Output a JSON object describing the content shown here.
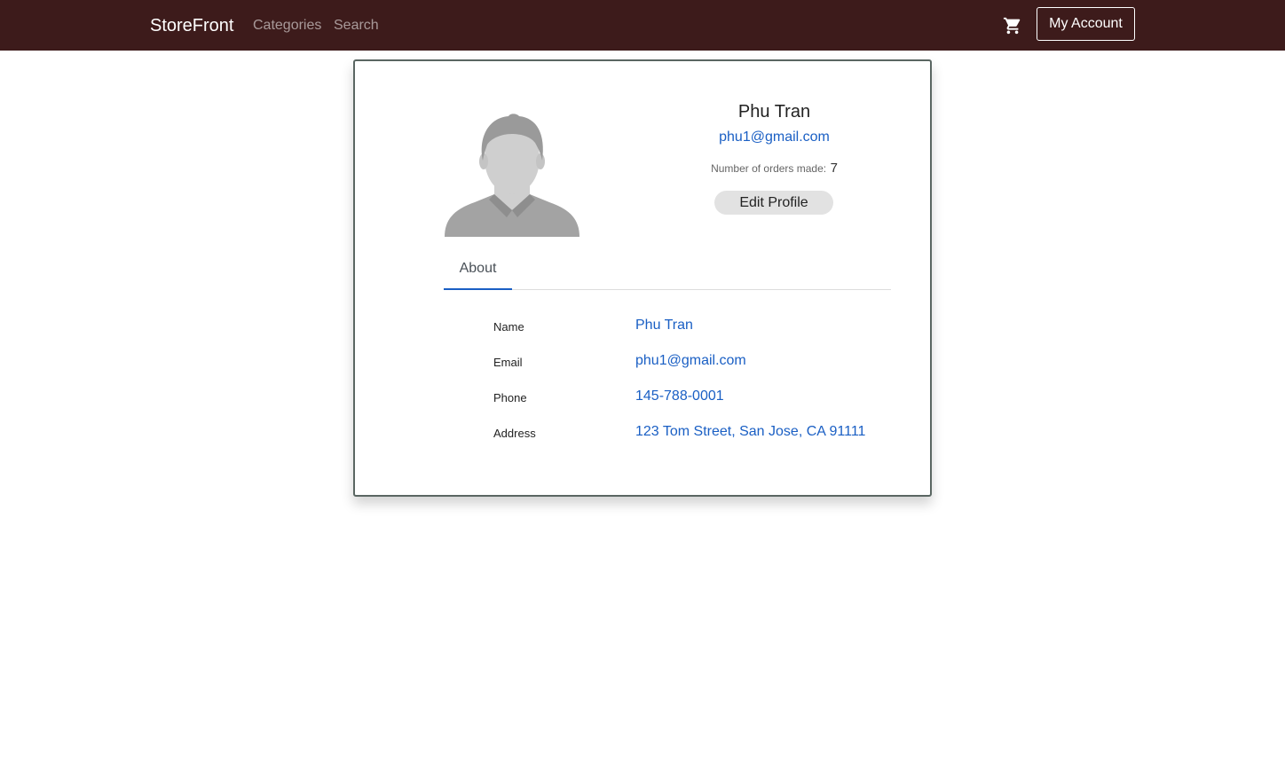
{
  "navbar": {
    "brand": "StoreFront",
    "links": [
      "Categories",
      "Search"
    ],
    "cart_icon": "shopping-cart-icon",
    "account_button": "My Account",
    "background_color": "#3d1b1b"
  },
  "profile": {
    "name": "Phu Tran",
    "email": "phu1@gmail.com",
    "orders_label": "Number of orders made:",
    "orders_count": "7",
    "edit_button": "Edit Profile",
    "avatar_icon": "user-avatar-icon"
  },
  "tabs": [
    "About"
  ],
  "about": {
    "rows": [
      {
        "label": "Name",
        "value": "Phu Tran"
      },
      {
        "label": "Email",
        "value": "phu1@gmail.com"
      },
      {
        "label": "Phone",
        "value": "145-788-0001"
      },
      {
        "label": "Address",
        "value": "123 Tom Street, San Jose, CA 91111"
      }
    ]
  },
  "colors": {
    "accent": "#1a5fc4",
    "card_border": "#5a6662"
  }
}
